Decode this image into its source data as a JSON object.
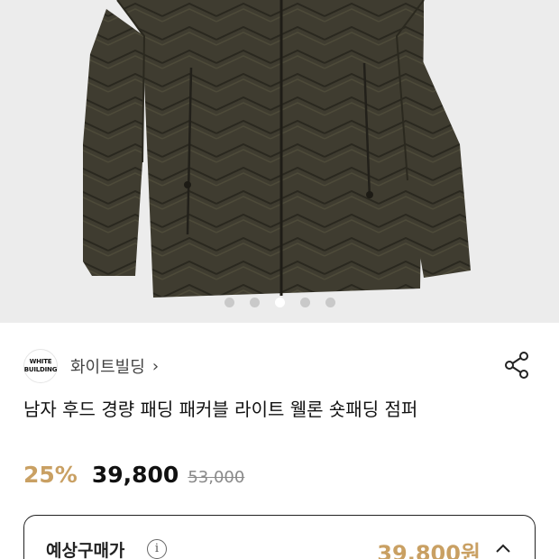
{
  "hero": {
    "image_alt": "olive hooded lightweight padded jacket",
    "slides": 5,
    "active_slide": 3
  },
  "brand": {
    "logo_line1": "WHITE",
    "logo_line2": "BUILDING",
    "name": "화이트빌딩",
    "chevron": "›"
  },
  "product": {
    "title": "남자 후드 경량 패딩 패커블 라이트 웰론 숏패딩 점퍼"
  },
  "price": {
    "discount": "25%",
    "sale": "39,800",
    "original": "53,000"
  },
  "estimate": {
    "label": "예상구매가",
    "info": "i",
    "value": "39,800원"
  },
  "colors": {
    "accent": "#c9a063",
    "jacket": "#3e3b2f",
    "background": "#ececec"
  },
  "icons": [
    "share-icon",
    "info-icon",
    "chevron-up-icon",
    "chevron-right-icon"
  ]
}
